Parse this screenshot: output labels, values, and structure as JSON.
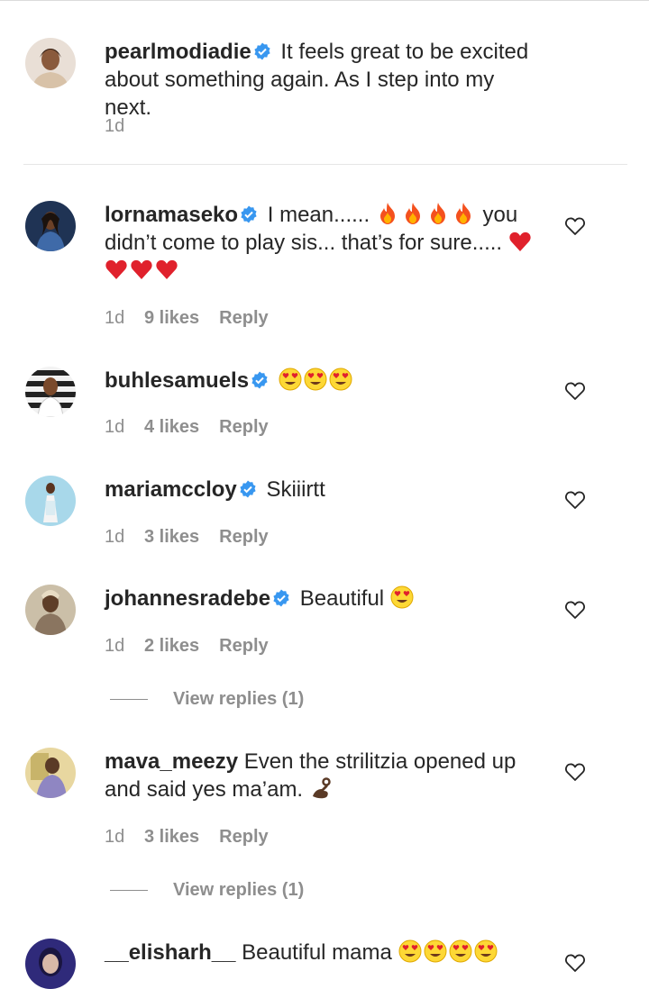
{
  "comments": [
    {
      "username": "pearlmodiadie",
      "text": "It feels great to be excited about something again. As I step into my next.",
      "time": "1d",
      "avatar_color": "#b98c66"
    },
    {
      "username": "lornamaseko",
      "text_before": "I mean......",
      "text_after": "you didn’t come to play sis... that’s for sure.....",
      "emojis_fire": [
        "fire-emoji",
        "fire-emoji",
        "fire-emoji",
        "fire-emoji"
      ],
      "time": "1d",
      "likes": "9 likes",
      "reply": "Reply",
      "avatar_color": "#1f3354"
    },
    {
      "username": "buhlesamuels",
      "time": "1d",
      "likes": "4 likes",
      "reply": "Reply",
      "avatar_color": "#2b2b2b"
    },
    {
      "username": "mariamccloy",
      "text": "Skiiirtt",
      "time": "1d",
      "likes": "3 likes",
      "reply": "Reply",
      "avatar_color": "#8fc7dc"
    },
    {
      "username": "johannesradebe",
      "text": "Beautiful",
      "time": "1d",
      "likes": "2 likes",
      "reply": "Reply",
      "view_replies": "View replies (1)",
      "avatar_color": "#7a6a55"
    },
    {
      "username": "mava_meezy",
      "text": "Even the strilitzia opened up and said yes ma’am.",
      "time": "1d",
      "likes": "3 likes",
      "reply": "Reply",
      "view_replies": "View replies (1)",
      "avatar_color": "#8a7ab0"
    },
    {
      "username": "__elisharh__",
      "text": "Beautiful mama",
      "avatar_color": "#3b3a8a"
    }
  ],
  "colors": {
    "text": "#262626",
    "meta": "#8e8e8e",
    "verified": "#3897f0",
    "heart_red": "#e0212c"
  }
}
